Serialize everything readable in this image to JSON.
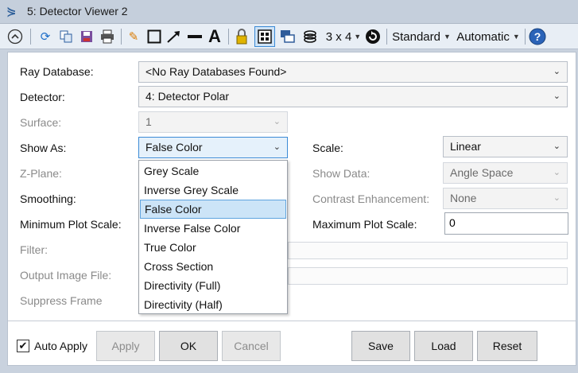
{
  "window": {
    "title": "5: Detector Viewer 2"
  },
  "toolbar": {
    "layout_label": "3 x 4",
    "standard_label": "Standard",
    "automatic_label": "Automatic"
  },
  "form": {
    "ray_database": {
      "label": "Ray Database:",
      "value": "<No Ray Databases Found>"
    },
    "detector": {
      "label": "Detector:",
      "value": "4: Detector Polar"
    },
    "surface": {
      "label": "Surface:",
      "value": "1"
    },
    "show_as": {
      "label": "Show As:",
      "value": "False Color"
    },
    "scale": {
      "label": "Scale:",
      "value": "Linear"
    },
    "z_plane": {
      "label": "Z-Plane:"
    },
    "show_data": {
      "label": "Show Data:",
      "value": "Angle Space"
    },
    "smoothing": {
      "label": "Smoothing:"
    },
    "contrast_enhancement": {
      "label": "Contrast Enhancement:",
      "value": "None"
    },
    "min_plot_scale": {
      "label": "Minimum Plot Scale:"
    },
    "max_plot_scale": {
      "label": "Maximum Plot Scale:",
      "value": "0"
    },
    "filter": {
      "label": "Filter:"
    },
    "output_image_file": {
      "label": "Output Image File:"
    },
    "suppress_frame": {
      "label": "Suppress Frame"
    }
  },
  "show_as_options": [
    "Grey Scale",
    "Inverse Grey Scale",
    "False Color",
    "Inverse False Color",
    "True Color",
    "Cross Section",
    "Directivity (Full)",
    "Directivity (Half)"
  ],
  "footer": {
    "auto_apply_label": "Auto Apply",
    "apply_label": "Apply",
    "ok_label": "OK",
    "cancel_label": "Cancel",
    "save_label": "Save",
    "load_label": "Load",
    "reset_label": "Reset"
  },
  "colors": {
    "accent": "#3b8ad6",
    "selection": "#cce4f7",
    "titlebar": "#c5cfdc"
  }
}
